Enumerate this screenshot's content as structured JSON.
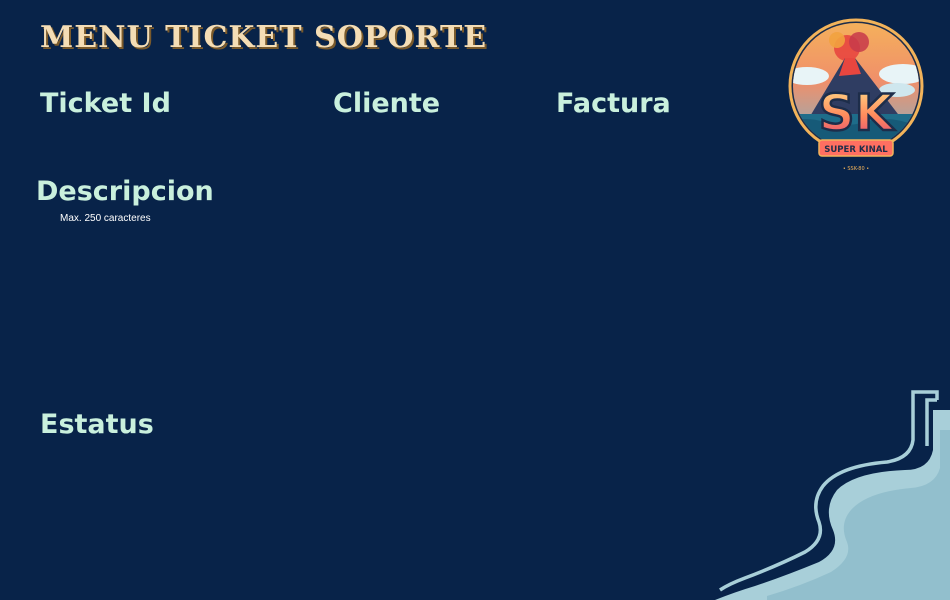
{
  "header": {
    "title": "MENU TICKET SOPORTE"
  },
  "form": {
    "ticket_id_label": "Ticket Id",
    "cliente_label": "Cliente",
    "factura_label": "Factura",
    "descripcion_label": "Descripcion",
    "descripcion_hint": "Max. 250 caracteres",
    "estatus_label": "Estatus"
  },
  "logo": {
    "brand_initials": "SK",
    "brand_name": "SUPER KINAL",
    "brand_tagline": "• SSK-80 •"
  },
  "colors": {
    "background": "#082349",
    "title": "#f4ddb5",
    "label": "#c9f0dd",
    "hint": "#ffffff",
    "decoration": "#a8cfd9"
  },
  "icons": {
    "logo": "super-kinal-volcano-logo",
    "decoration": "wave-corner-decoration"
  }
}
